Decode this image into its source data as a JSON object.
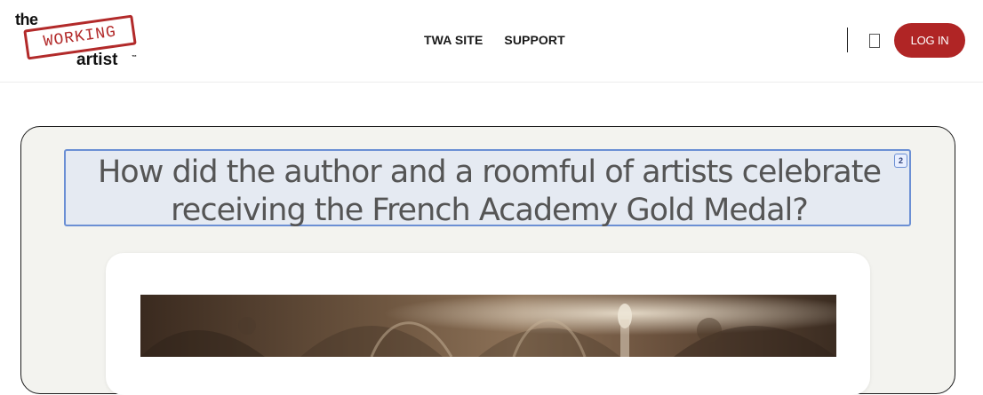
{
  "logo": {
    "the": "the",
    "stamp": "WORKING",
    "artist": "artist",
    "tm": "™"
  },
  "nav": {
    "items": [
      {
        "label": "TWA SITE"
      },
      {
        "label": "SUPPORT"
      }
    ]
  },
  "header": {
    "login_label": "LOG IN"
  },
  "main": {
    "question": "How did the author and a roomful of artists celebrate receiving the French Academy Gold Medal?",
    "badge": "2"
  },
  "colors": {
    "accent": "#b02525",
    "question_bg": "#e5eaf2",
    "question_border": "#6b8fd4",
    "card_bg": "#f3f3ef"
  },
  "icons": {
    "logo": "stamp-logo-icon",
    "image": "cathedral-painting-image"
  }
}
